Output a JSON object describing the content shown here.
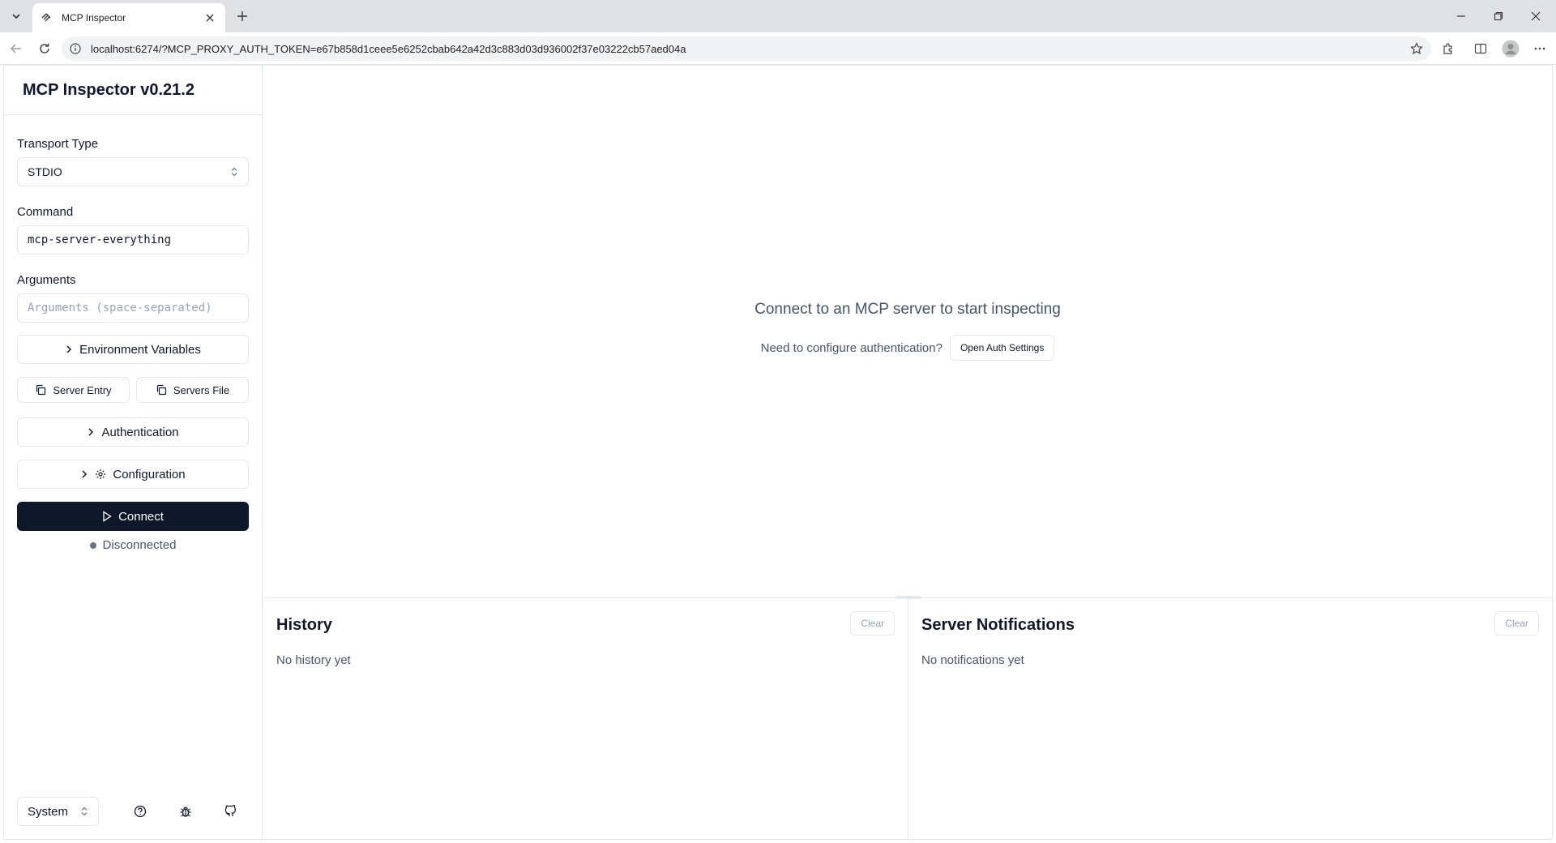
{
  "browser": {
    "tab_title": "MCP Inspector",
    "url": "localhost:6274/?MCP_PROXY_AUTH_TOKEN=e67b858d1ceee5e6252cbab642a42d3c883d03d936002f37e03222cb57aed04a"
  },
  "sidebar": {
    "title": "MCP Inspector v0.21.2",
    "transport_label": "Transport Type",
    "transport_value": "STDIO",
    "command_label": "Command",
    "command_value": "mcp-server-everything",
    "arguments_label": "Arguments",
    "arguments_placeholder": "Arguments (space-separated)",
    "env_button": "Environment Variables",
    "server_entry_button": "Server Entry",
    "servers_file_button": "Servers File",
    "auth_button": "Authentication",
    "config_button": "Configuration",
    "connect_button": "Connect",
    "status": "Disconnected",
    "theme_value": "System"
  },
  "main": {
    "empty_message": "Connect to an MCP server to start inspecting",
    "auth_prompt": "Need to configure authentication?",
    "auth_button": "Open Auth Settings",
    "history_title": "History",
    "history_clear": "Clear",
    "history_empty": "No history yet",
    "notifications_title": "Server Notifications",
    "notifications_clear": "Clear",
    "notifications_empty": "No notifications yet"
  }
}
